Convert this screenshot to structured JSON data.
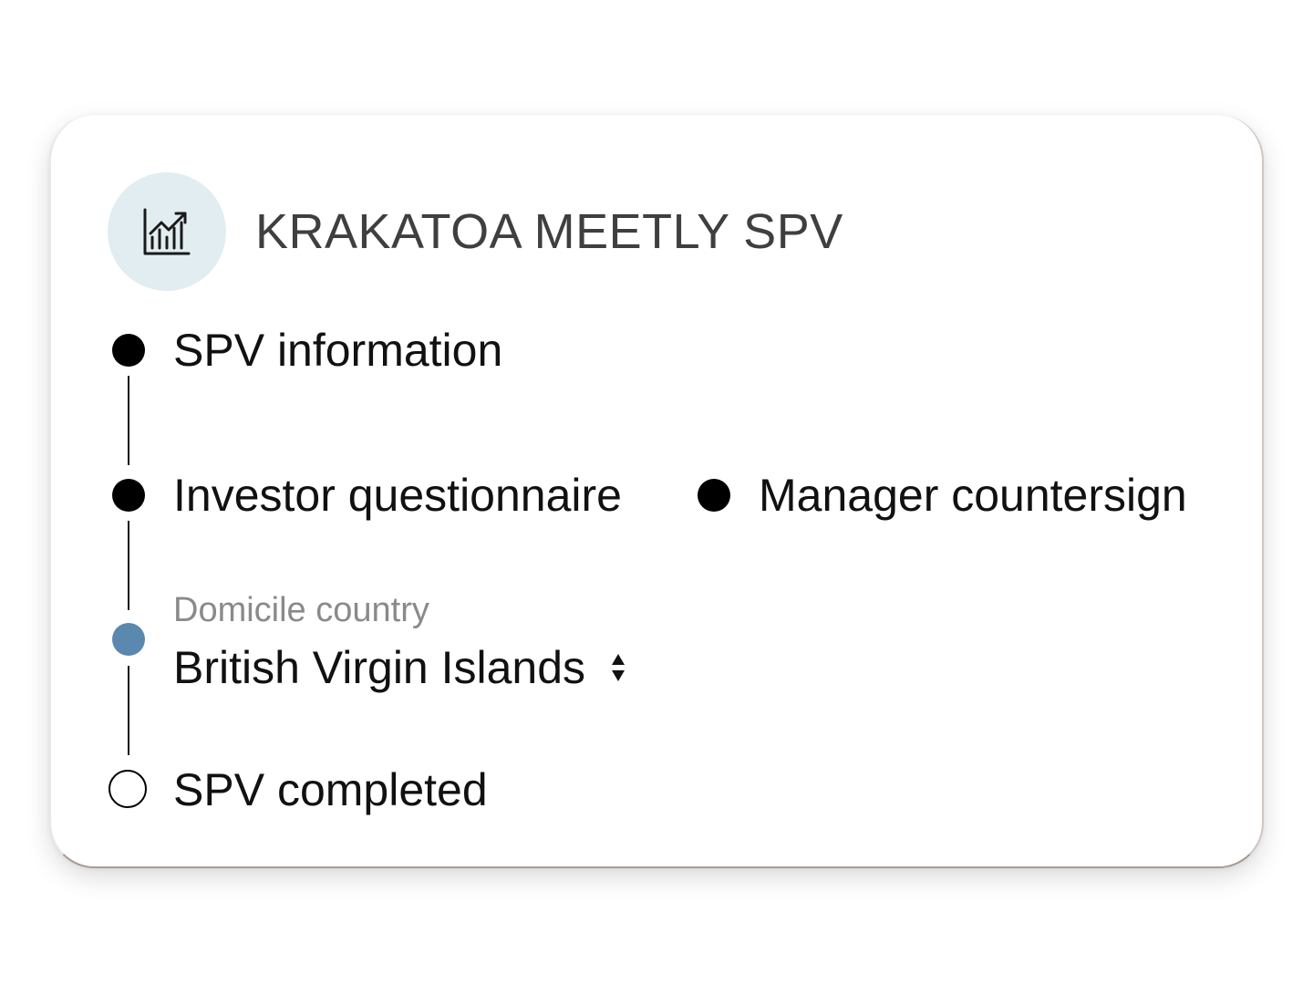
{
  "card": {
    "title": "KRAKATOA MEETLY SPV",
    "icon": "chart-growth-icon"
  },
  "steps": [
    {
      "label": "SPV information",
      "status": "done"
    },
    {
      "label": "Investor questionnaire",
      "status": "done"
    },
    {
      "label": "Manager countersign",
      "status": "done"
    },
    {
      "status": "current"
    },
    {
      "label": "SPV completed",
      "status": "pending"
    }
  ],
  "domicile": {
    "label": "Domicile country",
    "value": "British Virgin Islands",
    "icon": "sort-chevrons-icon"
  },
  "colors": {
    "icon_bg": "#e2edf1",
    "current_dot": "#5b88ae",
    "title": "#3f3f3f",
    "muted_label": "#8a8a8a"
  }
}
